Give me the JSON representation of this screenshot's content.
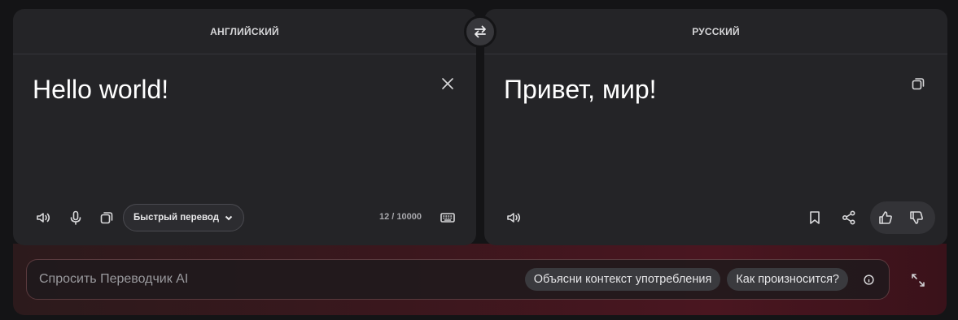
{
  "source": {
    "language": "АНГЛИЙСКИЙ",
    "text": "Hello world!",
    "mode_label": "Быстрый перевод",
    "counter": "12 / 10000"
  },
  "target": {
    "language": "РУССКИЙ",
    "text": "Привет, мир!"
  },
  "ask": {
    "placeholder": "Спросить Переводчик AI",
    "chips": [
      "Объясни контекст употребления",
      "Как произносится?"
    ]
  },
  "icons": {
    "swap": "swap-arrows-icon",
    "clear": "close-icon",
    "copy": "copy-icon",
    "speaker": "speaker-icon",
    "mic": "microphone-icon",
    "keyboard": "keyboard-icon",
    "bookmark": "bookmark-icon",
    "share": "share-icon",
    "like": "thumbs-up-icon",
    "dislike": "thumbs-down-icon",
    "info": "info-icon",
    "expand": "expand-icon"
  }
}
